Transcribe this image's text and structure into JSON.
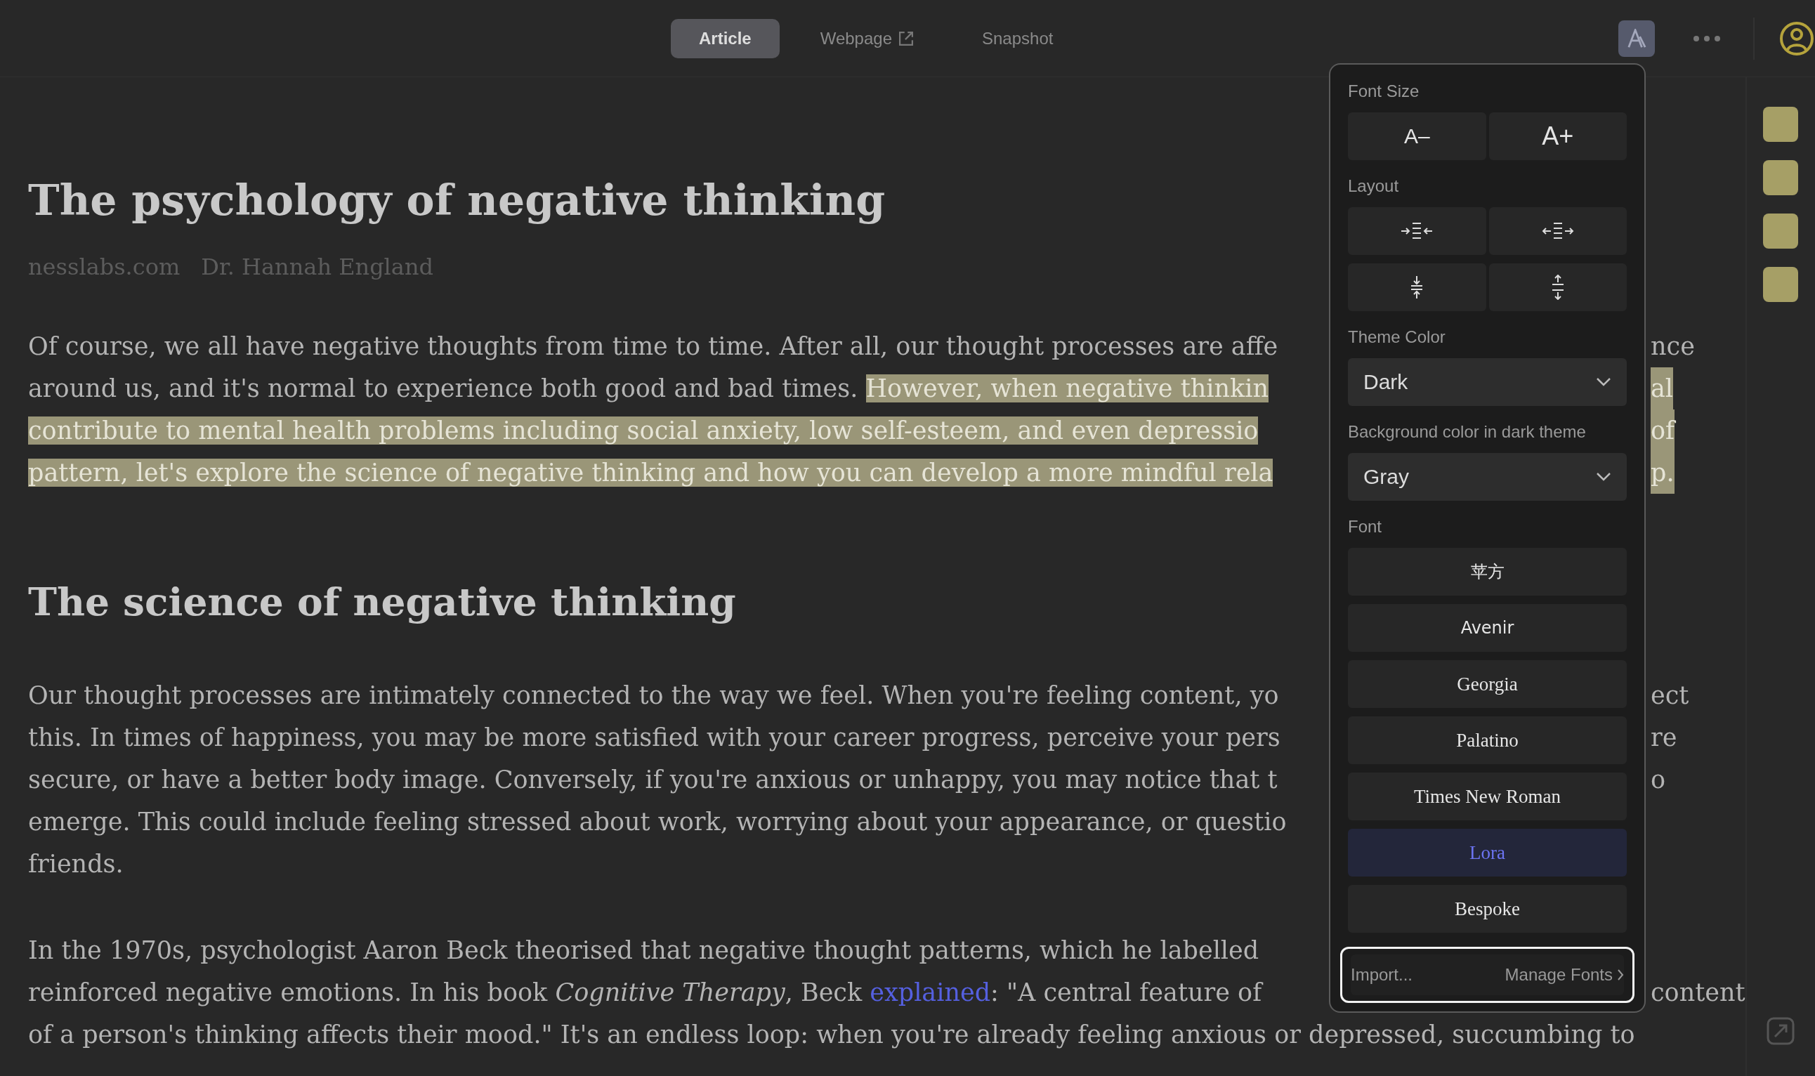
{
  "top_bar": {
    "tabs": [
      {
        "label": "Article",
        "selected": true,
        "external_link": false
      },
      {
        "label": "Webpage",
        "selected": false,
        "external_link": true
      },
      {
        "label": "Snapshot",
        "selected": false,
        "external_link": false
      }
    ]
  },
  "article": {
    "title": "The psychology of negative thinking",
    "source": "nesslabs.com",
    "author": "Dr. Hannah England",
    "blocks": [
      {
        "kind": "paragraph",
        "lines": [
          {
            "segments": [
              {
                "kind": "text",
                "text": "Of course, we all have negative thoughts from time to time. After all, our thought processes are affe"
              }
            ],
            "tail": {
              "kind": "text",
              "text": "nce"
            }
          },
          {
            "segments": [
              {
                "kind": "text",
                "text": "around us, and it's normal to experience both good and bad times. "
              },
              {
                "kind": "highlight",
                "text": "However, when negative thinkin"
              }
            ],
            "tail": {
              "kind": "highlight",
              "text": "al"
            }
          },
          {
            "segments": [
              {
                "kind": "highlight",
                "text": "contribute to mental health problems including social anxiety, low self-esteem, and even depressio"
              }
            ],
            "tail": {
              "kind": "highlight",
              "text": "of"
            }
          },
          {
            "segments": [
              {
                "kind": "highlight",
                "text": "pattern, let's explore the science of negative thinking and how you can develop a more mindful rela"
              }
            ],
            "tail": {
              "kind": "highlight",
              "text": "p."
            }
          }
        ]
      },
      {
        "kind": "heading",
        "text": "The science of negative thinking"
      },
      {
        "kind": "paragraph",
        "lines": [
          {
            "segments": [
              {
                "kind": "text",
                "text": "Our thought processes are intimately connected to the way we feel. When you're feeling content, yo"
              }
            ],
            "tail": {
              "kind": "text",
              "text": "ect"
            }
          },
          {
            "segments": [
              {
                "kind": "text",
                "text": "this. In times of happiness, you may be more satisfied with your career progress, perceive your pers"
              }
            ],
            "tail": {
              "kind": "text",
              "text": "re"
            }
          },
          {
            "segments": [
              {
                "kind": "text",
                "text": "secure, or have a better body image. Conversely, if you're anxious or unhappy, you may notice that t"
              }
            ],
            "tail": {
              "kind": "text",
              "text": "o"
            }
          },
          {
            "segments": [
              {
                "kind": "text",
                "text": "emerge. This could include feeling stressed about work, worrying about your appearance, or questio"
              }
            ]
          },
          {
            "segments": [
              {
                "kind": "text",
                "text": "friends."
              }
            ]
          }
        ]
      },
      {
        "kind": "paragraph",
        "lines": [
          {
            "segments": [
              {
                "kind": "text",
                "text": "In the 1970s, psychologist Aaron Beck theorised that negative thought patterns, which he labelled"
              }
            ]
          },
          {
            "segments": [
              {
                "kind": "text",
                "text": "reinforced negative emotions. In his book *Cognitive Therapy*, Beck "
              },
              {
                "kind": "link",
                "text": "explained"
              },
              {
                "kind": "text",
                "text": ": \"A central feature of"
              }
            ],
            "tail": {
              "kind": "text",
              "text": "content"
            }
          },
          {
            "segments": [
              {
                "kind": "text",
                "text": "of a person's thinking affects their mood.\" It's an endless loop: when you're already feeling anxious or depressed, succumbing to"
              }
            ]
          }
        ]
      }
    ]
  },
  "settings_panel": {
    "font_size": {
      "label": "Font Size",
      "buttons": [
        "A–",
        "A+"
      ]
    },
    "layout": {
      "label": "Layout"
    },
    "theme_color": {
      "label": "Theme Color",
      "value": "Dark"
    },
    "dark_background": {
      "label": "Background color in dark theme",
      "value": "Gray"
    },
    "font": {
      "label": "Font",
      "options": [
        {
          "label": "苹方",
          "kind": "sans",
          "selected": false
        },
        {
          "label": "Avenir",
          "kind": "sans",
          "selected": false
        },
        {
          "label": "Georgia",
          "kind": "serif",
          "selected": false
        },
        {
          "label": "Palatino",
          "kind": "serif",
          "selected": false
        },
        {
          "label": "Times New Roman",
          "kind": "serif",
          "selected": false
        },
        {
          "label": "Lora",
          "kind": "serif",
          "selected": true
        },
        {
          "label": "Bespoke",
          "kind": "serif",
          "selected": false
        }
      ]
    },
    "import": "Import...",
    "manage_fonts": "Manage Fonts"
  }
}
